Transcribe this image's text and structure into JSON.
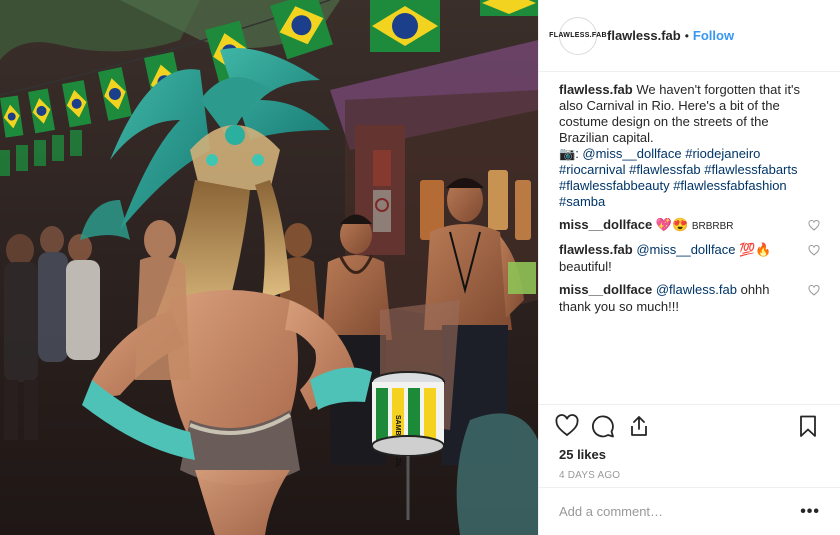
{
  "header": {
    "avatar_text": "FLAWLESS.FAB",
    "username": "flawless.fab",
    "separator": "•",
    "follow_label": "Follow"
  },
  "caption": {
    "username": "flawless.fab",
    "text": "We haven't forgotten that it's also Carnival in Rio. Here's a bit of the costume design on the streets of the Brazilian capital.",
    "camera_emoji": "📷",
    "credit": ": @miss__dollface",
    "tags": [
      "#riodejaneiro",
      "#riocarnival",
      "#flawlessfab",
      "#flawlessfabarts",
      "#flawlessfabbeauty",
      "#flawlessfabfashion",
      "#samba"
    ]
  },
  "comments": [
    {
      "username": "miss__dollface",
      "emojis": "💖😍",
      "text": "BRBRBR"
    },
    {
      "username": "flawless.fab",
      "mention": "@miss__dollface",
      "emojis": "💯🔥",
      "text": "beautiful!"
    },
    {
      "username": "miss__dollface",
      "mention": "@flawless.fab",
      "text": "ohhh thank you so much!!!"
    }
  ],
  "actions": {
    "likes": "25 likes",
    "time": "4 DAYS AGO"
  },
  "add_comment": {
    "placeholder": "Add a comment…",
    "more_label": "•••"
  },
  "photo": {
    "drum_text": "SAMBA BRAZIL"
  },
  "colors": {
    "link": "#3897f0",
    "hashtag": "#003569",
    "muted": "#999999",
    "border": "#efefef"
  }
}
